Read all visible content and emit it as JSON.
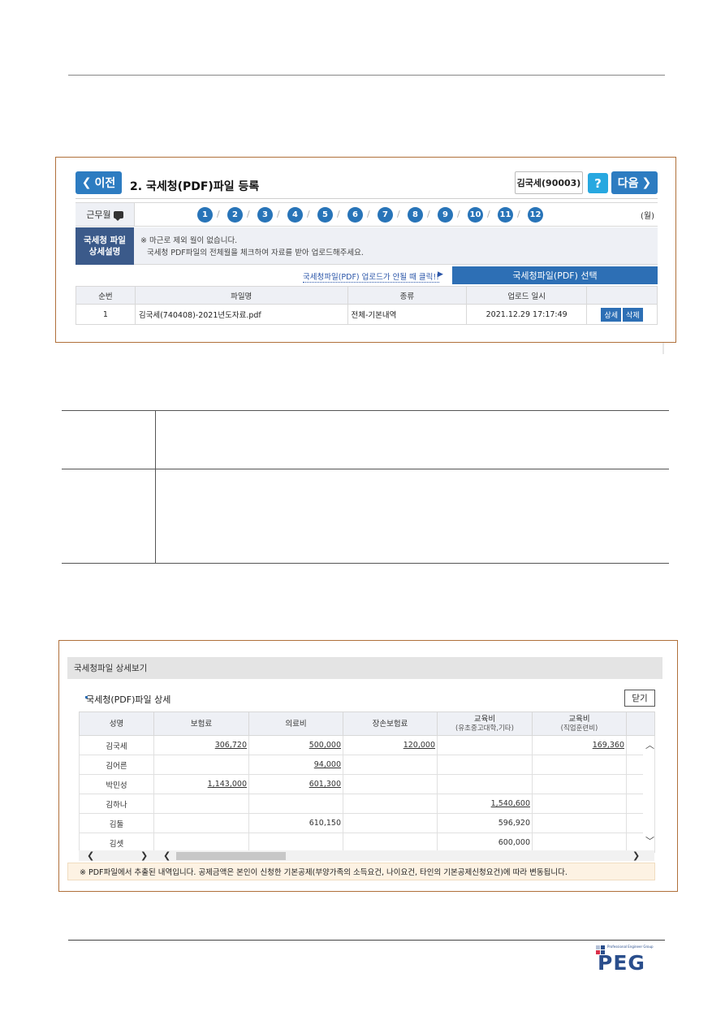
{
  "panel1": {
    "prev_label": "이전",
    "title": "2. 국세청(PDF)파일 등록",
    "user": "김국세(90003)",
    "help_label": "?",
    "next_label": "다음",
    "month_label": "근무월",
    "months": [
      "1",
      "2",
      "3",
      "4",
      "5",
      "6",
      "7",
      "8",
      "9",
      "10",
      "11",
      "12"
    ],
    "unit": "(월)",
    "desc_title_1": "국세청 파일",
    "desc_title_2": "상세설명",
    "desc_line1": "※ 마근로 제외 월이 없습니다.",
    "desc_line2": "국세청 PDF파일의 전체월을 체크하여 자료를 받아 업로드해주세요.",
    "fail_link": "국세청파일(PDF) 업로드가 안될 때 클릭!!",
    "fail_arrow": "▶",
    "select_button": "국세청파일(PDF) 선택",
    "table_headers": [
      "순번",
      "파일명",
      "종류",
      "업로드 일시",
      ""
    ],
    "rows": [
      {
        "no": "1",
        "file": "김국세(740408)-2021년도자료.pdf",
        "type": "전체-기본내역",
        "date": "2021.12.29 17:17:49",
        "detail": "상세",
        "delete": "삭제"
      }
    ]
  },
  "panel2": {
    "header": "국세청파일 상세보기",
    "subtitle": "국세청(PDF)파일 상세",
    "close_label": "닫기",
    "columns": [
      {
        "label": "성명",
        "sub": ""
      },
      {
        "label": "보험료",
        "sub": ""
      },
      {
        "label": "의료비",
        "sub": ""
      },
      {
        "label": "장손보험료",
        "sub": ""
      },
      {
        "label": "교육비",
        "sub": "(유초중고대학,기타)"
      },
      {
        "label": "교육비",
        "sub": "(직업훈련비)"
      }
    ],
    "rows": [
      [
        "김국세",
        "306,720",
        "500,000",
        "120,000",
        "",
        "169,360"
      ],
      [
        "김어른",
        "",
        "94,000",
        "",
        "",
        ""
      ],
      [
        "박민성",
        "1,143,000",
        "601,300",
        "",
        "",
        ""
      ],
      [
        "김하나",
        "",
        "",
        "",
        "1,540,600",
        ""
      ],
      [
        "김둘",
        "",
        "610,150",
        "",
        "596,920",
        ""
      ],
      [
        "김셋",
        "",
        "",
        "",
        "600,000",
        ""
      ]
    ],
    "note": "※ PDF파일에서 추출된 내역입니다. 공제금액은 본인이 신청한 기본공제(부양가족의 소득요건, 나이요건, 타인의 기본공제신청요건)에 따라 변동됩니다."
  },
  "logo": {
    "small_text": "Professional Engineer Group",
    "text": "PEG",
    "colors": {
      "primary": "#2a4e8c",
      "accent": "#d9304a"
    }
  }
}
